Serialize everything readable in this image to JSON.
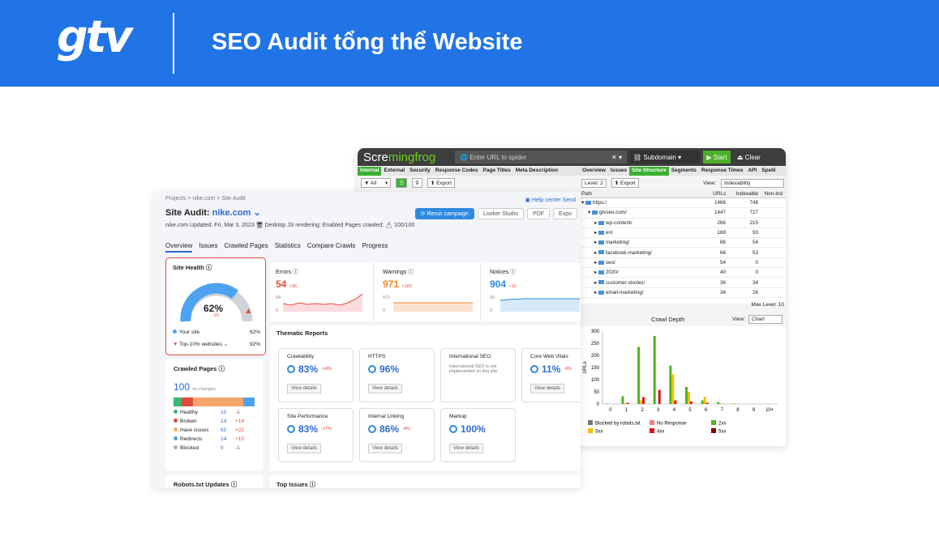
{
  "banner": {
    "logo": "gtv",
    "title": "SEO Audit tổng thể Website",
    "bg": "#2074e5"
  },
  "screamingfrog": {
    "logo_a": "Scre",
    "logo_b": "mingfrog",
    "url_placeholder": "Enter URL to spider",
    "mode": "Subdomain",
    "start": "▶ Start",
    "clear": "Clear",
    "left_tabs": [
      "Internal",
      "External",
      "Security",
      "Response Codes",
      "Page Titles",
      "Meta Description"
    ],
    "right_tabs": [
      "Overview",
      "Issues",
      "Site Structure",
      "Segments",
      "Response Times",
      "API",
      "Spelli"
    ],
    "filter": "All",
    "export": "Export",
    "level": "Level: 2",
    "view_label": "View:",
    "view_value": "Indexability",
    "tree_headers": [
      "Path",
      "URLs",
      "Indexable",
      "Non-Ind"
    ],
    "tree_rows": [
      {
        "path": "https:/",
        "urls": "1468",
        "idx": "748"
      },
      {
        "path": "gtvseo.com/",
        "urls": "1447",
        "idx": "727"
      },
      {
        "path": "wp-content/",
        "urls": "266",
        "idx": "215"
      },
      {
        "path": "en/",
        "urls": "188",
        "idx": "93"
      },
      {
        "path": "marketing/",
        "urls": "86",
        "idx": "54"
      },
      {
        "path": "facebook-marketing/",
        "urls": "66",
        "idx": "53"
      },
      {
        "path": "seo/",
        "urls": "54",
        "idx": "0"
      },
      {
        "path": "2020/",
        "urls": "40",
        "idx": "0"
      },
      {
        "path": "customer-stories/",
        "urls": "36",
        "idx": "34"
      },
      {
        "path": "email-marketing/",
        "urls": "34",
        "idx": "26"
      }
    ],
    "max_level": "Max Level: 10",
    "crawl_title": "Crawl Depth",
    "chart_view": "Chart",
    "chart_ylabel": "URLs"
  },
  "chart_data": {
    "type": "bar",
    "title": "Crawl Depth",
    "ylabel": "URLs",
    "xlabel": "",
    "categories": [
      "0",
      "1",
      "2",
      "3",
      "4",
      "5",
      "6",
      "7",
      "8",
      "9",
      "10+"
    ],
    "ylim": [
      0,
      300
    ],
    "yticks": [
      0,
      50,
      100,
      150,
      200,
      250,
      300
    ],
    "series": [
      {
        "name": "Blocked by robots.txt",
        "color": "#777777",
        "values": [
          0,
          0,
          0,
          0,
          0,
          0,
          0,
          0,
          0,
          0,
          0
        ]
      },
      {
        "name": "No Response",
        "color": "#f08080",
        "values": [
          0,
          0,
          0,
          0,
          0,
          0,
          0,
          0,
          0,
          0,
          0
        ]
      },
      {
        "name": "2xx",
        "color": "#56b21a",
        "values": [
          1,
          32,
          235,
          280,
          158,
          70,
          15,
          8,
          2,
          0,
          0
        ]
      },
      {
        "name": "3xx",
        "color": "#f2c200",
        "values": [
          0,
          3,
          15,
          0,
          122,
          50,
          30,
          3,
          0,
          0,
          0
        ]
      },
      {
        "name": "4xx",
        "color": "#d9141c",
        "values": [
          0,
          5,
          28,
          58,
          15,
          10,
          5,
          0,
          0,
          0,
          0
        ]
      },
      {
        "name": "5xx",
        "color": "#8b0000",
        "values": [
          0,
          0,
          0,
          0,
          0,
          0,
          0,
          0,
          0,
          0,
          0
        ]
      }
    ]
  },
  "semrush": {
    "breadcrumb": "Projects  >  nike.com  >  Site Audit",
    "title_prefix": "Site Audit: ",
    "domain": "nike.com ⌄",
    "meta": "nike.com    Updated: Fri, Mar 3, 2023    🖥 Desktop    JS rendering: Enabled    Pages crawled: ⚠ 100/100",
    "help": "Help center   Send",
    "buttons": [
      "⟳ Rerun campaign",
      "Looker Studio",
      "PDF",
      "Expo"
    ],
    "tabs": [
      "Overview",
      "Issues",
      "Crawled Pages",
      "Statistics",
      "Compare Crawls",
      "Progress"
    ],
    "site_health": {
      "title": "Site Health  ⓘ",
      "score": "62%",
      "delta": "-23",
      "your_site": "Your site",
      "your_val": "62%",
      "top": "Top-10% websites ⌄",
      "top_val": "92%"
    },
    "errors": {
      "label": "Errors  ⓘ",
      "value": "54",
      "delta": "+36",
      "y1": "54",
      "y0": "0"
    },
    "warnings": {
      "label": "Warnings  ⓘ",
      "value": "971",
      "delta": "+183",
      "y1": "971",
      "y0": "0"
    },
    "notices": {
      "label": "Notices  ⓘ",
      "value": "904",
      "delta": "+10",
      "y1": "1K",
      "y0": "0"
    },
    "thematic_title": "Thematic Reports",
    "thematic": [
      {
        "name": "Crawlability",
        "value": "83%",
        "delta": "-14%"
      },
      {
        "name": "HTTPS",
        "value": "96%",
        "delta": ""
      },
      {
        "name": "International SEO",
        "value": "",
        "delta": "",
        "note": "International SEO is not implemented on this site."
      },
      {
        "name": "Core Web Vitals",
        "value": "11%",
        "delta": "-6%"
      },
      {
        "name": "Site Performance",
        "value": "83%",
        "delta": "-17%"
      },
      {
        "name": "Internal Linking",
        "value": "86%",
        "delta": "-4%"
      },
      {
        "name": "Markup",
        "value": "100%",
        "delta": ""
      }
    ],
    "view_details": "View details",
    "crawled": {
      "title": "Crawled Pages  ⓘ",
      "count": "100",
      "sub": "no changes",
      "rows": [
        {
          "n": "Healthy",
          "v": "10",
          "d": "-1",
          "c": "#3bb873"
        },
        {
          "n": "Broken",
          "v": "14",
          "d": "+14",
          "c": "#e04c3c"
        },
        {
          "n": "Have issues",
          "v": "62",
          "d": "+22",
          "c": "#f5a76a"
        },
        {
          "n": "Redirects",
          "v": "14",
          "d": "+10",
          "c": "#4da3f0"
        },
        {
          "n": "Blocked",
          "v": "0",
          "d": "-1",
          "c": "#b0b0b0"
        }
      ]
    },
    "robots": "Robots.txt Updates  ⓘ",
    "top_issues": "Top Issues  ⓘ"
  }
}
